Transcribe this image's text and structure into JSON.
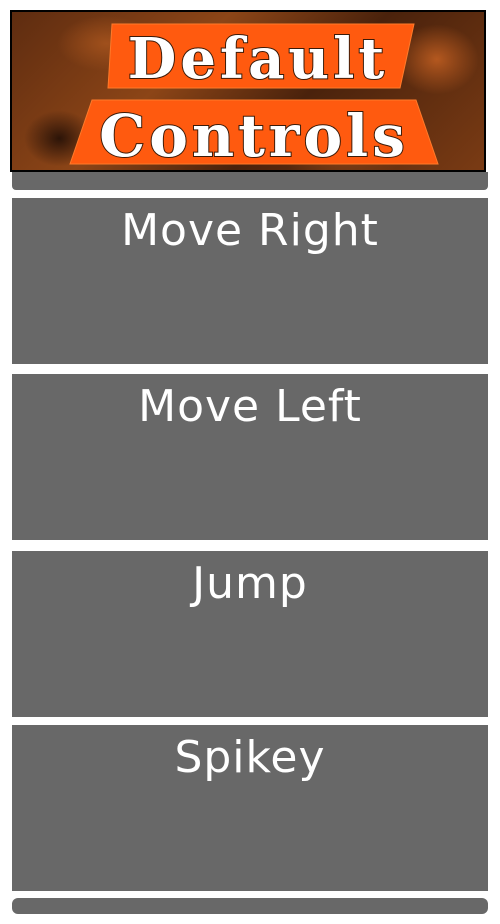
{
  "header": {
    "title_line1": "Default",
    "title_line2": "Controls",
    "banner_color": "#ff5a0f",
    "background_theme": "dark orange rocky texture"
  },
  "controls": [
    {
      "label": "Move Right"
    },
    {
      "label": "Move Left"
    },
    {
      "label": "Jump"
    },
    {
      "label": "Spikey"
    }
  ],
  "colors": {
    "button_bg": "#686868",
    "button_text": "#ffffff",
    "gap": "#ffffff"
  }
}
